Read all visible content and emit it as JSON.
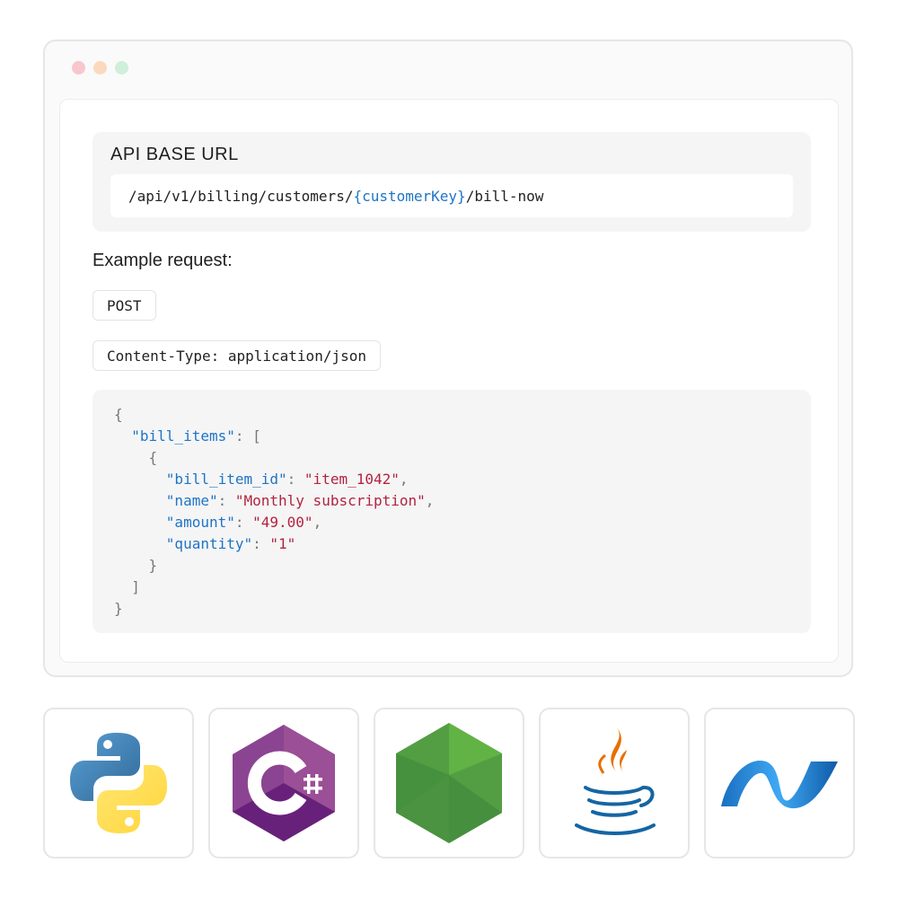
{
  "window": {
    "dot_colors": [
      "#f7c7cc",
      "#fbd9bd",
      "#cfeedb"
    ]
  },
  "api": {
    "title": "API BASE URL",
    "url_prefix": "/api/v1/billing/customers/",
    "url_param": "{customerKey}",
    "url_suffix": "/bill-now"
  },
  "example": {
    "label": "Example request:",
    "method": "POST",
    "header": "Content-Type: application/json"
  },
  "code_lines": [
    [
      {
        "t": "p",
        "v": "{"
      }
    ],
    [
      {
        "t": "p",
        "v": "  "
      },
      {
        "t": "k",
        "v": "\"bill_items\""
      },
      {
        "t": "p",
        "v": ": ["
      }
    ],
    [
      {
        "t": "p",
        "v": "    {"
      }
    ],
    [
      {
        "t": "p",
        "v": "      "
      },
      {
        "t": "k",
        "v": "\"bill_item_id\""
      },
      {
        "t": "p",
        "v": ": "
      },
      {
        "t": "s",
        "v": "\"item_1042\""
      },
      {
        "t": "p",
        "v": ","
      }
    ],
    [
      {
        "t": "p",
        "v": "      "
      },
      {
        "t": "k",
        "v": "\"name\""
      },
      {
        "t": "p",
        "v": ": "
      },
      {
        "t": "s",
        "v": "\"Monthly subscription\""
      },
      {
        "t": "p",
        "v": ","
      }
    ],
    [
      {
        "t": "p",
        "v": "      "
      },
      {
        "t": "k",
        "v": "\"amount\""
      },
      {
        "t": "p",
        "v": ": "
      },
      {
        "t": "s",
        "v": "\"49.00\""
      },
      {
        "t": "p",
        "v": ","
      }
    ],
    [
      {
        "t": "p",
        "v": "      "
      },
      {
        "t": "k",
        "v": "\"quantity\""
      },
      {
        "t": "p",
        "v": ": "
      },
      {
        "t": "s",
        "v": "\"1\""
      }
    ],
    [
      {
        "t": "p",
        "v": "    }"
      }
    ],
    [
      {
        "t": "p",
        "v": "  ]"
      }
    ],
    [
      {
        "t": "p",
        "v": "}"
      }
    ]
  ],
  "languages": [
    "python-icon",
    "csharp-icon",
    "nodejs-icon",
    "java-icon",
    "dotnet-icon"
  ],
  "colors": {
    "accent_key": "#1e74c6",
    "string": "#b22340"
  }
}
